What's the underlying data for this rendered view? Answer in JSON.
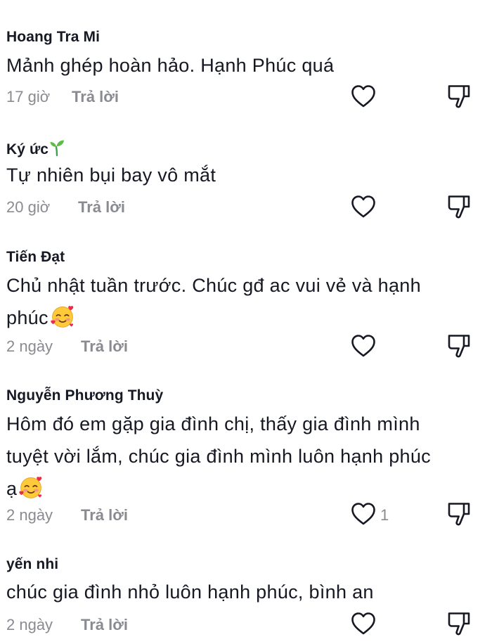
{
  "comments": [
    {
      "username": "Hoang Tra Mi",
      "text": "Mảnh ghép hoàn hảo. Hạnh Phúc quá",
      "time": "17 giờ",
      "reply_label": "Trả lời",
      "like_count": ""
    },
    {
      "username": "Ký ức",
      "username_icon": "seedling-icon",
      "text": "Tự nhiên bụi bay vô mắt",
      "time": "20 giờ",
      "reply_label": "Trả lời",
      "like_count": ""
    },
    {
      "username": "Tiến Đạt",
      "text_line1": "Chủ nhật tuần trước. Chúc gđ ac vui vẻ và hạnh",
      "text_line2": "phúc",
      "text_emoji": "smiling-face-with-hearts-icon",
      "time": "2 ngày",
      "reply_label": "Trả lời",
      "like_count": ""
    },
    {
      "username": "Nguyễn Phương Thuỳ",
      "text_line1": "Hôm đó em gặp gia đình chị, thấy gia đình mình",
      "text_line2": "tuyệt vời lắm, chúc gia đình mình luôn hạnh phúc",
      "text_line3": "ạ",
      "text_emoji": "smiling-face-with-hearts-icon",
      "time": "2 ngày",
      "reply_label": "Trả lời",
      "like_count": "1"
    },
    {
      "username": "yến nhi",
      "text": "chúc gia đình nhỏ luôn hạnh phúc, bình an",
      "time": "2 ngày",
      "reply_label": "Trả lời",
      "like_count": ""
    }
  ],
  "colors": {
    "text": "#161823",
    "muted": "#8a8b91",
    "icon_stroke": "#161823"
  }
}
